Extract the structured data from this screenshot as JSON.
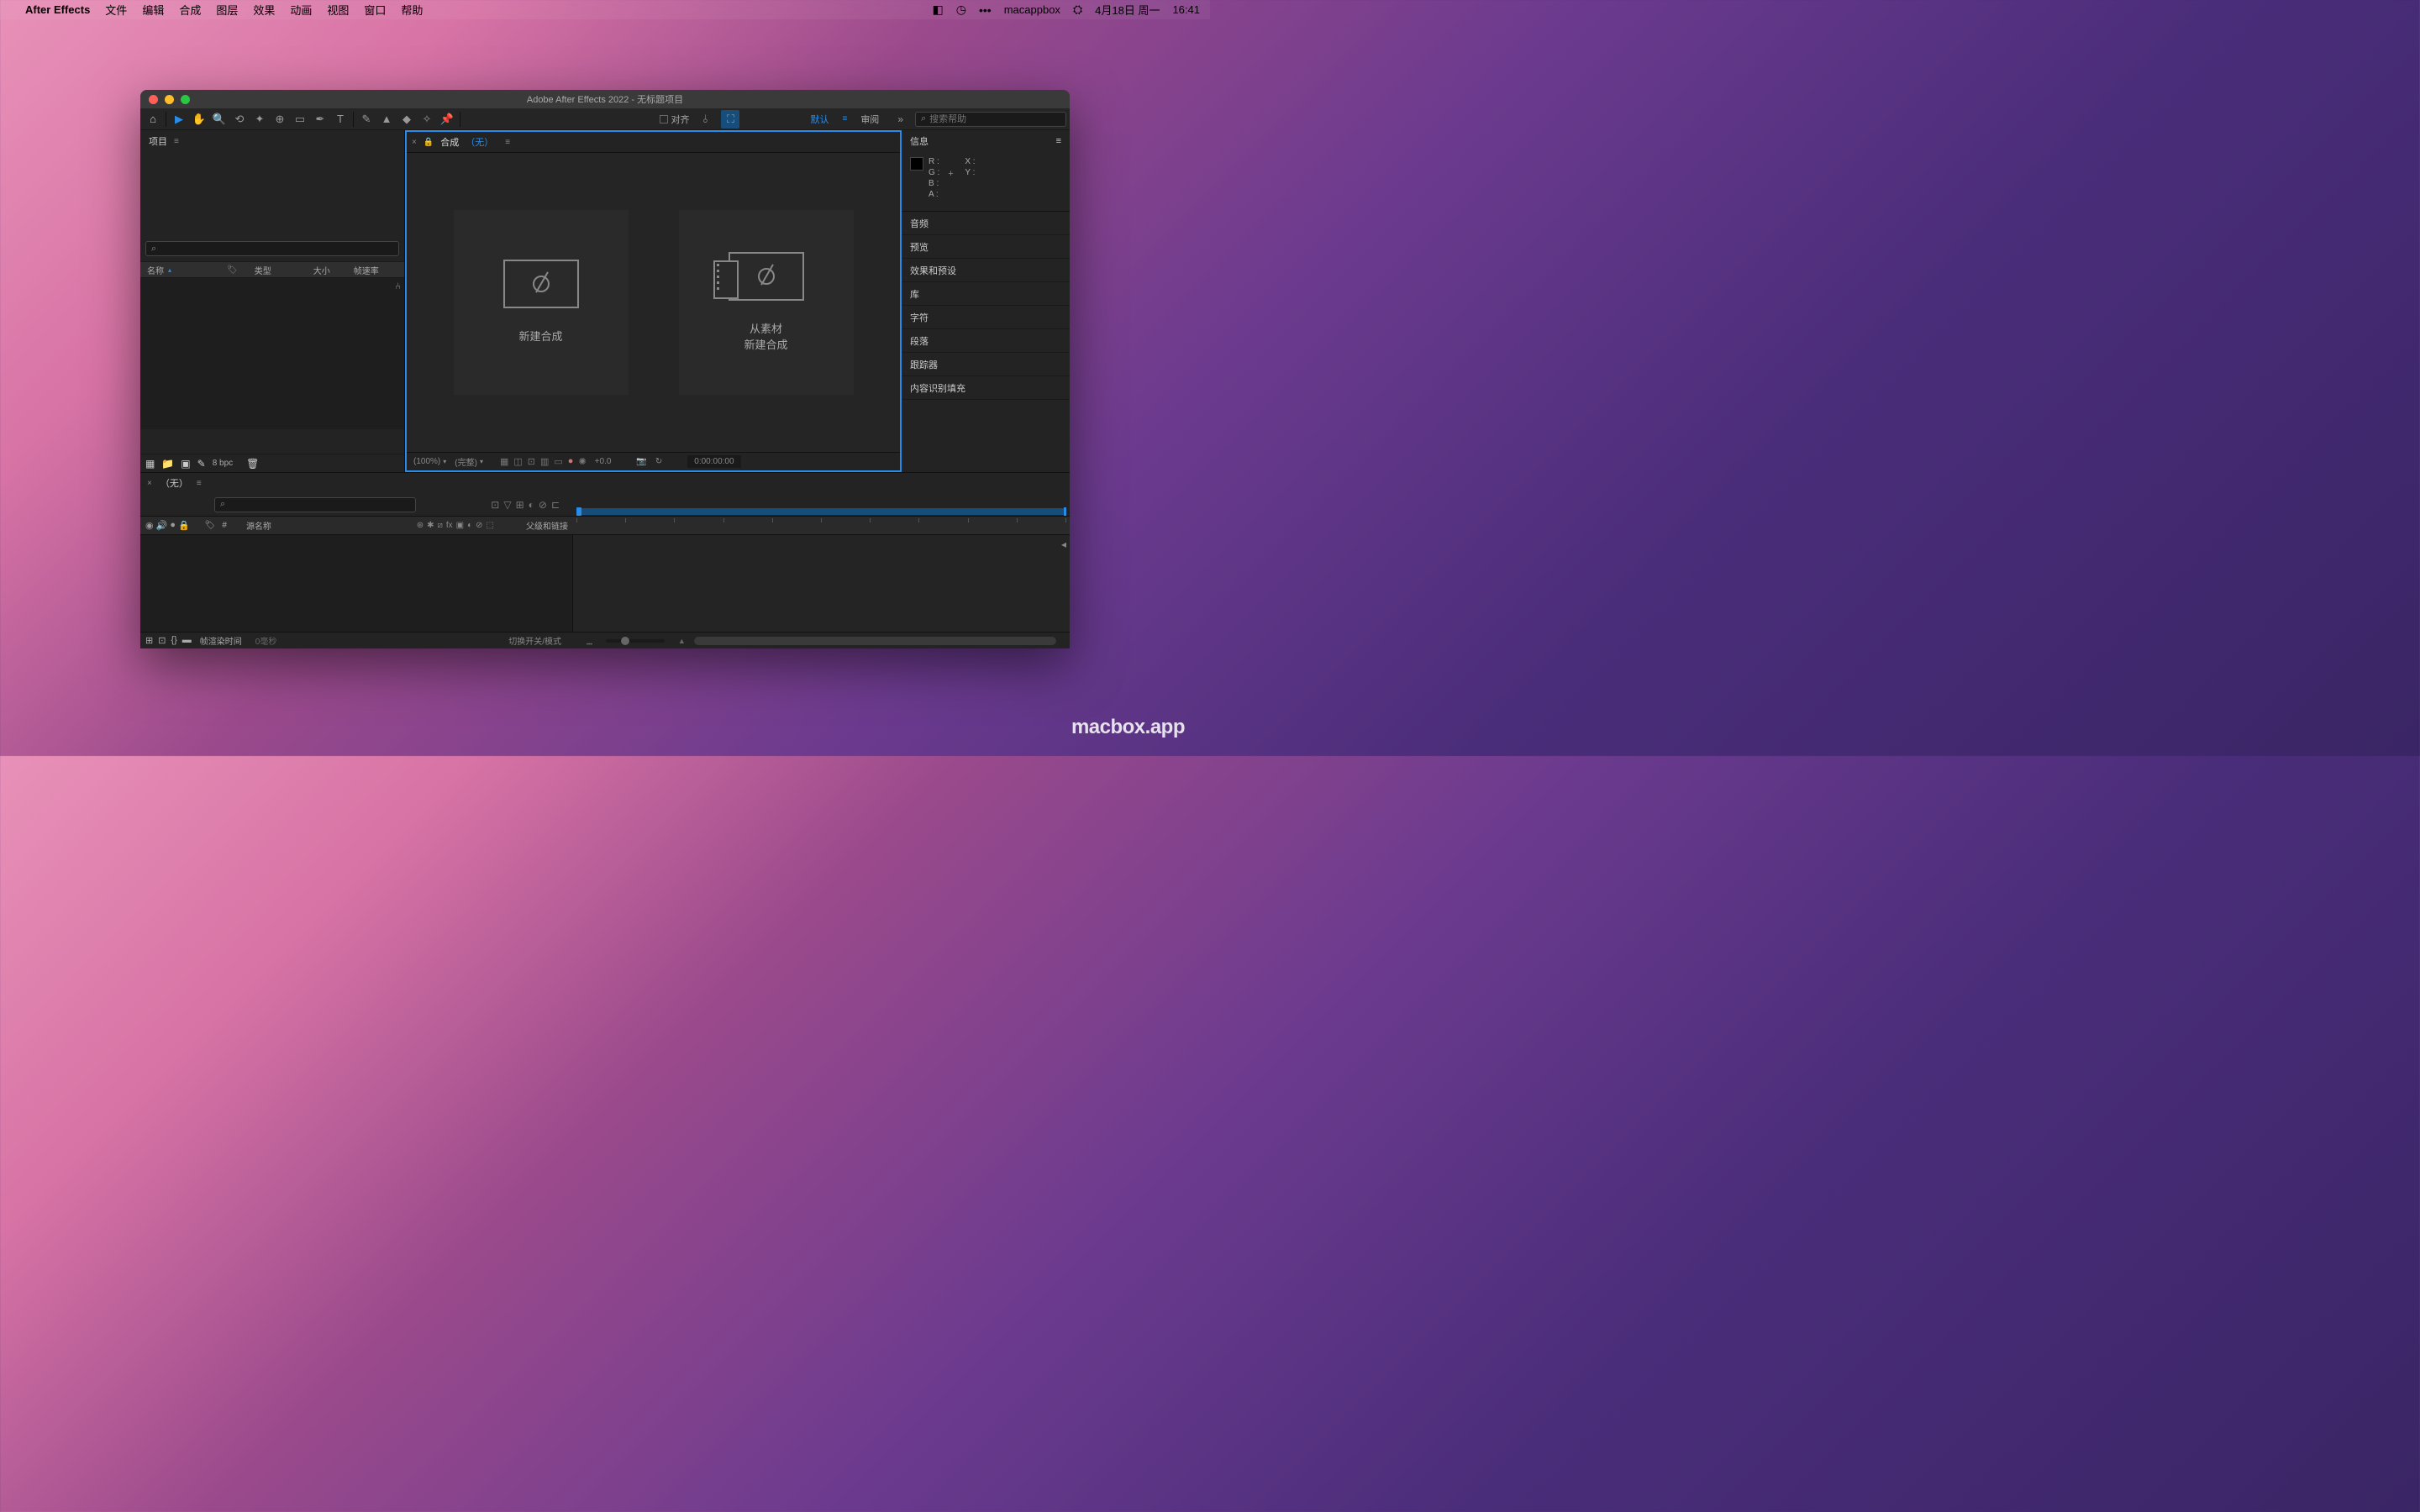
{
  "menubar": {
    "app_name": "After Effects",
    "items": [
      "文件",
      "编辑",
      "合成",
      "图层",
      "效果",
      "动画",
      "视图",
      "窗口",
      "帮助"
    ],
    "right": {
      "user": "macappbox",
      "date": "4月18日 周一",
      "time": "16:41"
    }
  },
  "window": {
    "title": "Adobe After Effects 2022 - 无标题项目"
  },
  "toolbar": {
    "align_label": "对齐",
    "workspace_default": "默认",
    "workspace_review": "审阅",
    "search_placeholder": "搜索帮助"
  },
  "project": {
    "title": "项目",
    "columns": {
      "name": "名称",
      "type": "类型",
      "size": "大小",
      "fps": "帧速率"
    },
    "footer": {
      "bpc": "8 bpc"
    }
  },
  "composition": {
    "tab_label": "合成",
    "tab_none": "（无）",
    "new_comp": "新建合成",
    "from_footage_l1": "从素材",
    "from_footage_l2": "新建合成",
    "footer": {
      "zoom": "(100%)",
      "res": "(完整)",
      "exposure": "+0.0",
      "timecode": "0:00:00:00"
    }
  },
  "info": {
    "title": "信息",
    "r": "R :",
    "g": "G :",
    "b": "B :",
    "a": "A :",
    "x": "X :",
    "y": "Y :"
  },
  "side_panels": [
    "音频",
    "预览",
    "效果和预设",
    "库",
    "字符",
    "段落",
    "跟踪器",
    "内容识别填充"
  ],
  "timeline": {
    "tab_label": "（无）",
    "headers": {
      "source": "源名称",
      "parent": "父级和链接",
      "hash": "#"
    },
    "footer": {
      "render_label": "帧渲染时间",
      "render_time": "0毫秒",
      "switch_label": "切换开关/模式"
    }
  },
  "watermark": "macbox.app"
}
